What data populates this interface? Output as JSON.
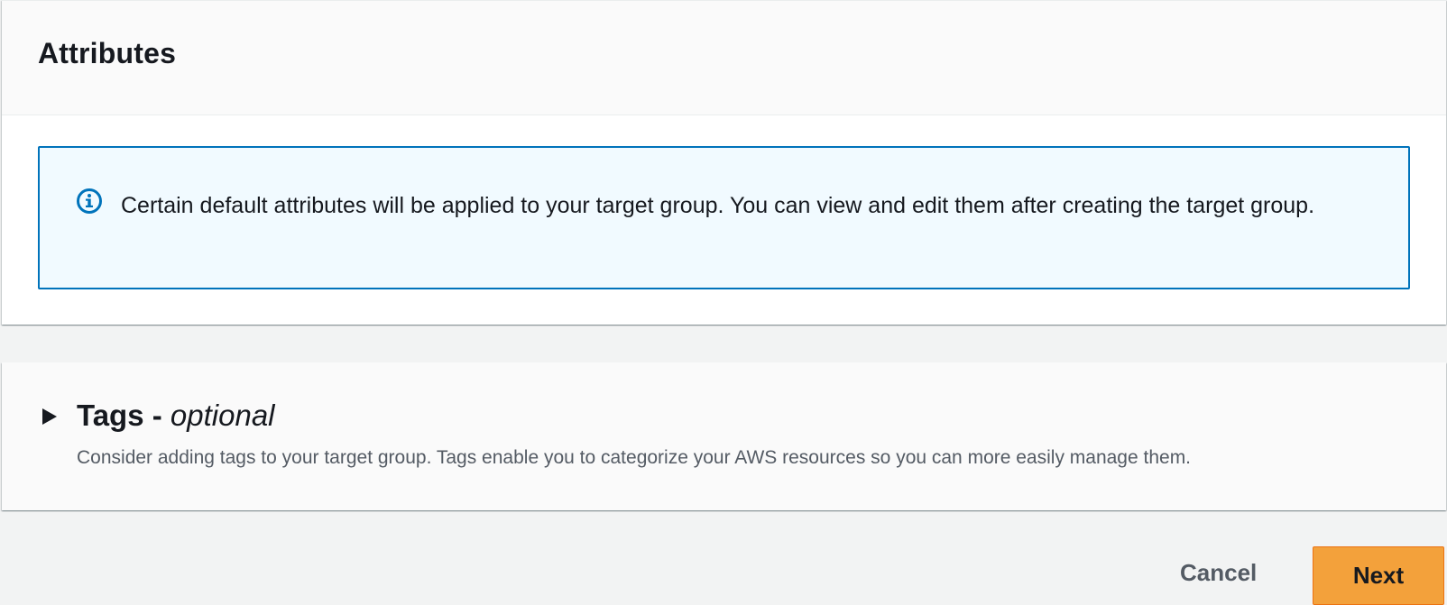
{
  "attributes": {
    "title": "Attributes",
    "alert": {
      "icon": "info-icon",
      "text": "Certain default attributes will be applied to your target group. You can view and edit them after creating the target group."
    }
  },
  "tags": {
    "toggle_icon": "caret-right-icon",
    "title": "Tags - ",
    "title_optional": "optional",
    "description": "Consider adding tags to your target group. Tags enable you to categorize your AWS resources so you can more easily manage them."
  },
  "footer": {
    "cancel_label": "Cancel",
    "next_label": "Next"
  },
  "colors": {
    "alert_border": "#0073bb",
    "alert_background": "#f1faff",
    "primary_button": "#f3a13b",
    "page_background": "#f2f3f3"
  }
}
